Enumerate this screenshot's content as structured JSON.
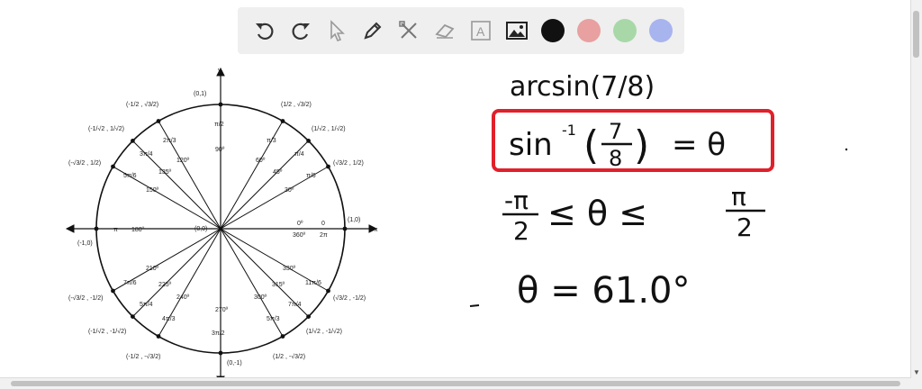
{
  "toolbar": {
    "tools": [
      {
        "name": "undo-icon"
      },
      {
        "name": "redo-icon"
      },
      {
        "name": "pointer-icon"
      },
      {
        "name": "pencil-icon"
      },
      {
        "name": "tools-icon"
      },
      {
        "name": "eraser-icon"
      },
      {
        "name": "text-icon",
        "label": "A"
      },
      {
        "name": "image-icon"
      }
    ],
    "colors": [
      "#111111",
      "#e8a0a0",
      "#a8d8a8",
      "#a8b4ee"
    ]
  },
  "unit_circle": {
    "axis_x": "x",
    "axis_y": "y",
    "origin": "(0,0)",
    "top": "(0,1)",
    "bottom": "(0,-1)",
    "left": "(-1,0)",
    "right": "(1,0)",
    "deg_90": "90º",
    "deg_120": "120º",
    "deg_135": "135º",
    "deg_150": "150º",
    "deg_180": "180º",
    "deg_210": "210º",
    "deg_225": "225º",
    "deg_240": "240º",
    "deg_270": "270º",
    "deg_300": "300º",
    "deg_315": "315º",
    "deg_330": "330º",
    "deg_0": "0º",
    "deg_360": "360º",
    "deg_60": "60º",
    "deg_45": "45º",
    "deg_30": "30º",
    "rad_pi": "π",
    "rad_0": "0",
    "rad_2pi": "2π",
    "rad_pi2_top": "π/2",
    "rad_3pi2": "3π/2",
    "rad_pi3": "π/3",
    "rad_pi4": "π/4",
    "rad_pi6": "π/6",
    "rad_2pi3": "2π/3",
    "rad_3pi4": "3π/4",
    "rad_5pi6": "5π/6",
    "rad_7pi6": "7π/6",
    "rad_5pi4": "5π/4",
    "rad_4pi3": "4π/3",
    "rad_5pi3": "5π/3",
    "rad_7pi4": "7π/4",
    "rad_11pi6": "11π/6",
    "pt_60": "(1/2 , √3/2)",
    "pt_45": "(1/√2 , 1/√2)",
    "pt_30": "(√3/2 , 1/2)",
    "pt_120": "(-1/2 , √3/2)",
    "pt_135": "(-1/√2 , 1/√2)",
    "pt_150": "(-√3/2 , 1/2)",
    "pt_210": "(-√3/2 , -1/2)",
    "pt_225": "(-1/√2 , -1/√2)",
    "pt_240": "(-1/2 , -√3/2)",
    "pt_300": "(1/2 , -√3/2)",
    "pt_315": "(1/√2 , -1/√2)",
    "pt_330": "(√3/2 , -1/2)"
  },
  "notes": {
    "line1": "arcsin(7/8)",
    "line2_left": "sin",
    "line2_exp": "-1",
    "line2_num": "7",
    "line2_den": "8",
    "line2_eq": "= θ",
    "line3_left_num": "-π",
    "line3_left_den": "2",
    "line3_mid": "≤ θ ≤",
    "line3_right_num": "π",
    "line3_right_den": "2",
    "line4": "θ = 61.0°"
  }
}
